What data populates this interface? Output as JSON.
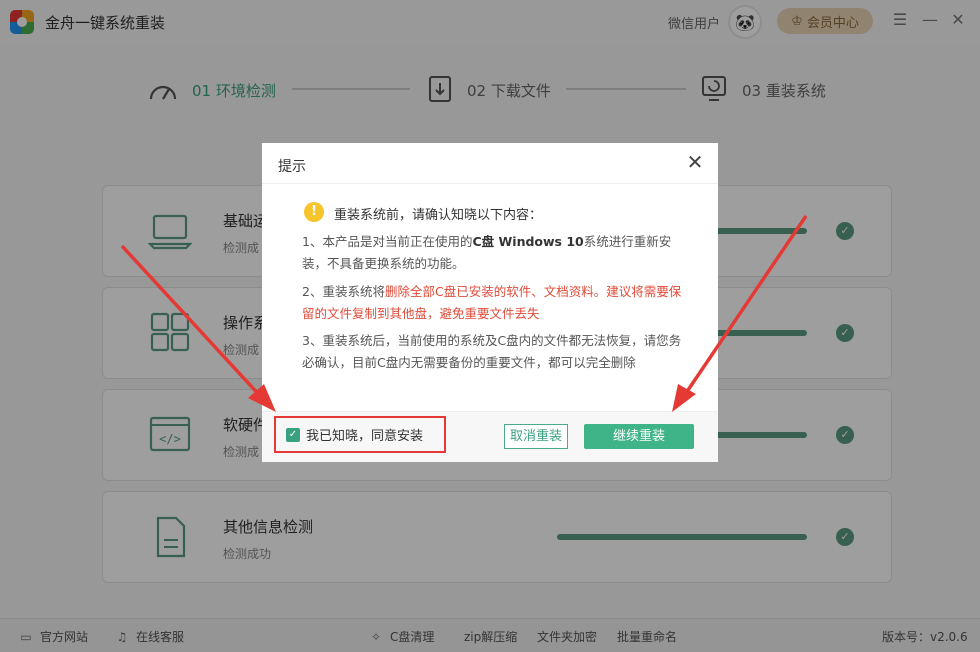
{
  "app": {
    "title": "金舟一键系统重装",
    "user": "微信用户",
    "vip_label": "会员中心"
  },
  "steps": [
    {
      "label": "01 环境检测"
    },
    {
      "label": "02 下载文件"
    },
    {
      "label": "03 重装系统"
    }
  ],
  "cards": [
    {
      "title": "基础运",
      "status": "检测成",
      "progress": 1.0
    },
    {
      "title": "操作系",
      "status": "检测成",
      "progress": 1.0
    },
    {
      "title": "软硬件",
      "status": "检测成",
      "progress": 1.0
    },
    {
      "title": "其他信息检测",
      "status": "检测成功",
      "progress": 1.0
    }
  ],
  "footer": {
    "website": "官方网站",
    "support": "在线客服",
    "tools": [
      "C盘清理",
      "zip解压缩",
      "文件夹加密",
      "批量重命名"
    ],
    "version": "版本号：v2.0.6"
  },
  "dialog": {
    "title": "提示",
    "heading": "重装系统前，请确认知晓以下内容：",
    "p1_a": "1、本产品是对当前正在使用的",
    "p1_b": "C盘 Windows 10",
    "p1_c": "系统进行重新安装，不具备更换系统的功能。",
    "p2_a": "2、重装系统将",
    "p2_b": "删除全部C盘已安装的软件、文档资料。建议将需要保留的文件复制到其他盘，避免重要文件丢失",
    "p3": "3、重装系统后，当前使用的系统及C盘内的文件都无法恢复，请您务必确认，目前C盘内无需要备份的重要文件，都可以完全删除",
    "agree_label": "我已知晓，同意安装",
    "cancel_label": "取消重装",
    "continue_label": "继续重装"
  },
  "colors": {
    "accent": "#3fb489",
    "warning": "#e04b3a",
    "arrow": "#e53935"
  }
}
